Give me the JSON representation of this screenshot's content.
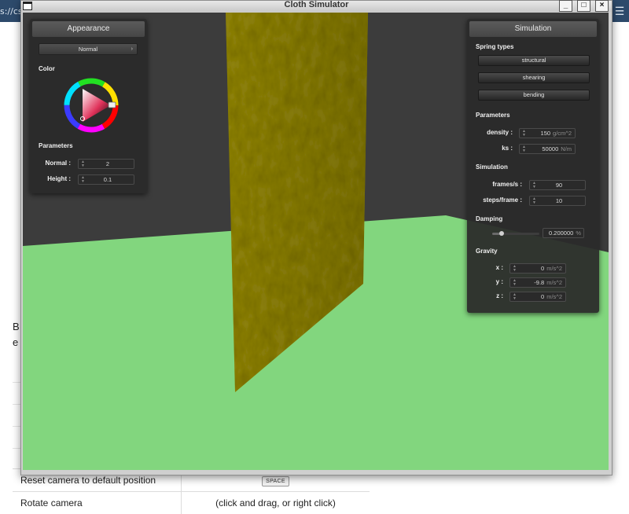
{
  "browser": {
    "url_fragment": "s://cs",
    "side_text_b": "B",
    "side_text_e": "e",
    "table_rows": [
      {
        "action": "Reset camera to default position",
        "key": "SPACE"
      },
      {
        "action": "Rotate camera",
        "key": "(click and drag, or right click)"
      }
    ]
  },
  "window": {
    "title": "Cloth Simulator",
    "minimize_label": "_",
    "maximize_label": "□",
    "close_label": "×"
  },
  "scene": {
    "floor_color": "#82d67e",
    "backdrop_color": "#3c3c3c",
    "cloth_color": "#9a8e08"
  },
  "appearance": {
    "header": "Appearance",
    "shader_mode": "Normal",
    "color_label": "Color",
    "parameters_label": "Parameters",
    "normal_label": "Normal :",
    "normal_value": "2",
    "height_label": "Height :",
    "height_value": "0.1"
  },
  "simulation": {
    "header": "Simulation",
    "spring_types_label": "Spring types",
    "springs": [
      "structural",
      "shearing",
      "bending"
    ],
    "parameters_label": "Parameters",
    "density_label": "density :",
    "density_value": "150",
    "density_unit": "g/cm^2",
    "ks_label": "ks :",
    "ks_value": "50000",
    "ks_unit": "N/m",
    "simulation_label": "Simulation",
    "fps_label": "frames/s :",
    "fps_value": "90",
    "steps_label": "steps/frame :",
    "steps_value": "10",
    "damping_label": "Damping",
    "damping_value": "0.200000",
    "damping_unit": "%",
    "damping_level": 0.2,
    "gravity_label": "Gravity",
    "gx_label": "x :",
    "gx_value": "0",
    "gy_label": "y :",
    "gy_value": "-9.8",
    "gz_label": "z :",
    "gz_value": "0",
    "gravity_unit": "m/s^2"
  }
}
